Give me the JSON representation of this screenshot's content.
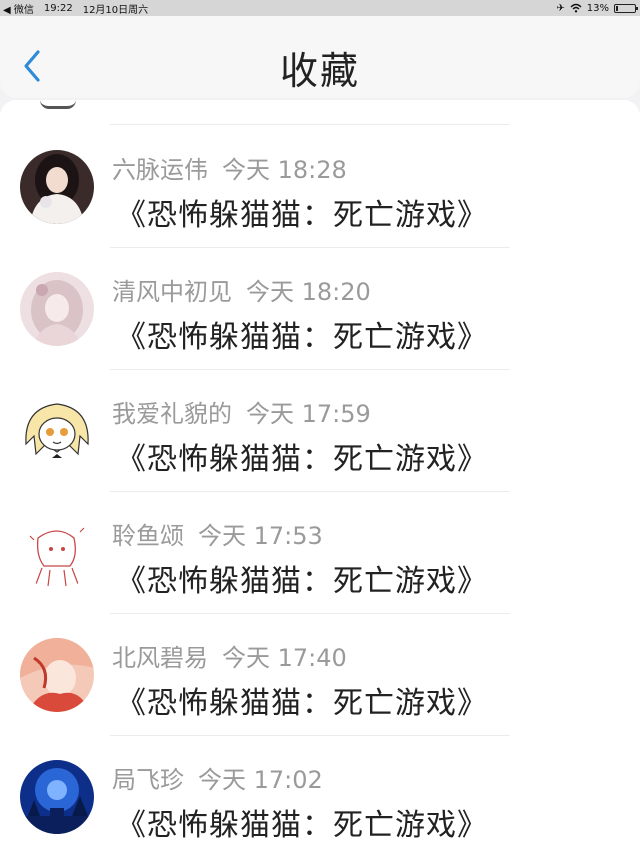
{
  "status_bar": {
    "back_app": "◀ 微信",
    "time": "19:22",
    "date": "12月10日周六",
    "battery": "13%",
    "battery_level": 0.13
  },
  "nav": {
    "title": "收藏",
    "back_icon": "chevron-left-icon",
    "accent_color": "#2f8bd8"
  },
  "items": [
    {
      "user": "六脉运伟",
      "time": "今天 18:28",
      "book": "《恐怖躲猫猫：死亡游戏》"
    },
    {
      "user": "清风中初见",
      "time": "今天 18:20",
      "book": "《恐怖躲猫猫：死亡游戏》"
    },
    {
      "user": "我爱礼貌的",
      "time": "今天 17:59",
      "book": "《恐怖躲猫猫：死亡游戏》"
    },
    {
      "user": "聆鱼颂",
      "time": "今天 17:53",
      "book": "《恐怖躲猫猫：死亡游戏》"
    },
    {
      "user": "北风碧易",
      "time": "今天 17:40",
      "book": "《恐怖躲猫猫：死亡游戏》"
    },
    {
      "user": "局飞珍",
      "time": "今天 17:02",
      "book": "《恐怖躲猫猫：死亡游戏》"
    }
  ]
}
